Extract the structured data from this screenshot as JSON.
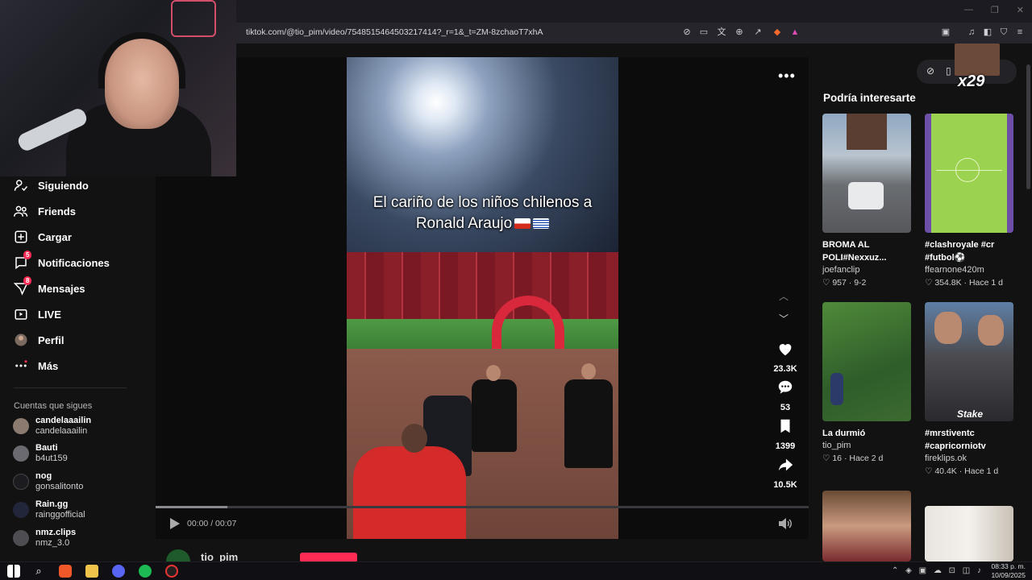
{
  "browser": {
    "url": "tiktok.com/@tio_pim/video/7548515464503217414?_r=1&_t=ZM-8zchaoT7xhA"
  },
  "nav": {
    "items": [
      {
        "label": "Siguiendo",
        "icon": "following-icon"
      },
      {
        "label": "Friends",
        "icon": "friends-icon"
      },
      {
        "label": "Cargar",
        "icon": "upload-icon"
      },
      {
        "label": "Notificaciones",
        "icon": "notifications-icon",
        "badge": "5"
      },
      {
        "label": "Mensajes",
        "icon": "messages-icon",
        "badge": "8"
      },
      {
        "label": "LIVE",
        "icon": "live-icon"
      },
      {
        "label": "Perfil",
        "icon": "profile-icon"
      },
      {
        "label": "Más",
        "icon": "more-icon"
      }
    ],
    "following_header": "Cuentas que sigues",
    "accounts": [
      {
        "name": "candelaaailin",
        "handle": "candelaaailin"
      },
      {
        "name": "Bauti",
        "handle": "b4ut159"
      },
      {
        "name": "nog",
        "handle": "gonsalitonto"
      },
      {
        "name": "Rain.gg",
        "handle": "rainggofficial"
      },
      {
        "name": "nmz.clips",
        "handle": "nmz_3.0"
      }
    ]
  },
  "video": {
    "caption_line1": "El cariño de los niños chilenos a",
    "caption_line2": "Ronald Araujo",
    "likes": "23.3K",
    "comments": "53",
    "saves": "1399",
    "shares": "10.5K",
    "time": "00:00 / 00:07",
    "progress": 0.11,
    "author": "tio_pim"
  },
  "right": {
    "header": "Podría interesarte",
    "overlay_count": "x29",
    "cards": [
      {
        "title_line1": "BROMA AL",
        "title_line2": "POLI#Nexxuz...",
        "author": "joefanclip",
        "likes": "957",
        "date": "9-2"
      },
      {
        "title_line1": "#clashroyale #cr",
        "title_line2": "#futbol⚽",
        "author": "ffearnone420m",
        "likes": "354.8K",
        "date": "Hace 1 d"
      },
      {
        "title_line1": "La durmió",
        "title_line2": "",
        "author": "tio_pim",
        "likes": "16",
        "date": "Hace 2 d"
      },
      {
        "title_line1": "#mrstiventc",
        "title_line2": "#capricorniotv",
        "author": "fireklips.ok",
        "likes": "40.4K",
        "date": "Hace 1 d"
      }
    ],
    "stake_label": "Stake"
  },
  "taskbar": {
    "time": "08:33 p. m.",
    "date": "10/09/2025"
  },
  "colors": {
    "accent": "#fe2c55",
    "background": "#121212"
  }
}
